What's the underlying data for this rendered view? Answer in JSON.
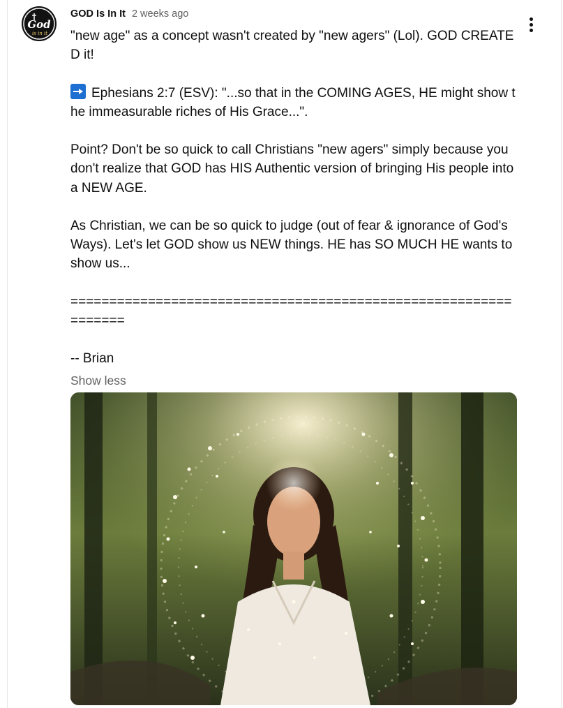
{
  "comment": {
    "author": "GOD Is In It",
    "time": "2 weeks ago",
    "avatar_text_top": "God",
    "avatar_text_bottom": "is in it",
    "paragraphs": {
      "p1": "\"new age\" as a concept wasn't created by \"new agers\" (Lol). GOD CREATED it!",
      "p2": "Ephesians 2:7 (ESV): \"...so that in the COMING AGES, HE might show the immeasurable riches of His Grace...\".",
      "p3": "Point? Don't be so quick to call Christians \"new agers\" simply because you don't realize that GOD has HIS Authentic version of bringing His people into a NEW AGE.",
      "p4": "As Christian, we can be so quick to judge (out of fear & ignorance of God's Ways). Let's let GOD show us NEW things. HE has SO MUCH HE wants to show us...",
      "divider": "================================================================",
      "signature": "-- Brian"
    },
    "show_less_label": "Show less",
    "icons": {
      "arrow": "right-arrow-emoji-icon",
      "menu": "more-vert-icon"
    },
    "colors": {
      "text": "#0f0f0f",
      "secondary": "#606060",
      "arrow_emoji": "#1d6fd1"
    }
  }
}
